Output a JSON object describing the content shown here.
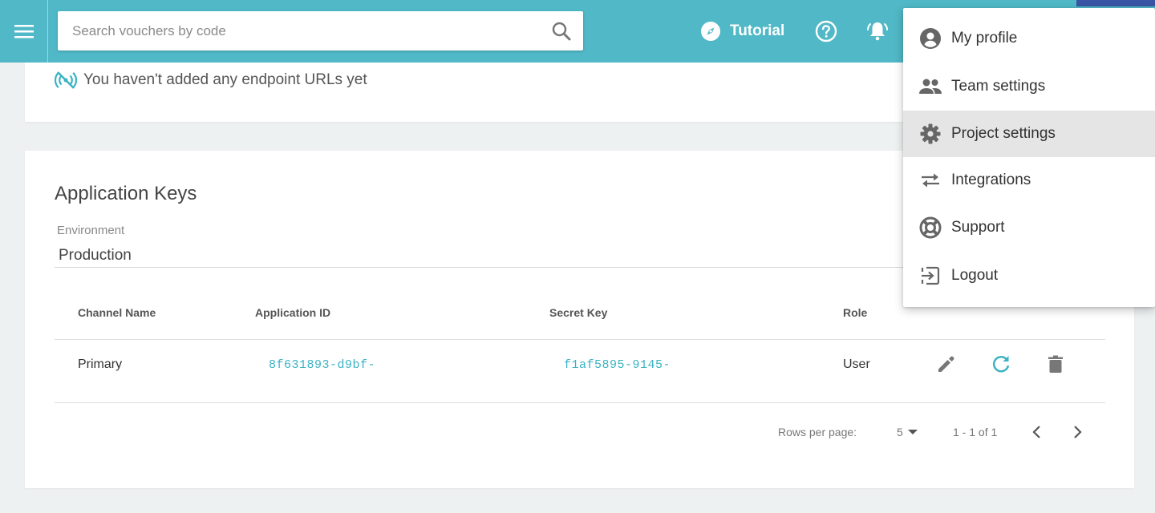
{
  "header": {
    "search_placeholder": "Search vouchers by code",
    "tutorial_label": "Tutorial",
    "accent_color": "#50b8c6"
  },
  "endpoints": {
    "empty_message": "You haven't added any endpoint URLs yet"
  },
  "app_keys": {
    "title": "Application Keys",
    "environment_label": "Environment",
    "environment_value": "Production",
    "columns": [
      "Channel Name",
      "Application ID",
      "Secret Key",
      "Role"
    ],
    "rows": [
      {
        "channel_name": "Primary",
        "application_id": "8f631893-d9bf-",
        "secret_key": "f1af5895-9145-",
        "role": "User"
      }
    ],
    "row_actions": [
      "pencil-icon",
      "refresh-icon",
      "trash-icon"
    ]
  },
  "pagination": {
    "rows_per_page_label": "Rows per page:",
    "rows_per_page_value": "5",
    "range_text": "1 - 1 of 1"
  },
  "user_menu": {
    "items": [
      {
        "label": "My profile",
        "icon": "account-circle-icon"
      },
      {
        "label": "Team settings",
        "icon": "people-icon"
      },
      {
        "label": "Project settings",
        "icon": "gear-icon",
        "active": true
      },
      {
        "label": "Integrations",
        "icon": "swap-arrows-icon"
      },
      {
        "label": "Support",
        "icon": "lifebuoy-icon"
      },
      {
        "label": "Logout",
        "icon": "logout-icon"
      }
    ]
  }
}
